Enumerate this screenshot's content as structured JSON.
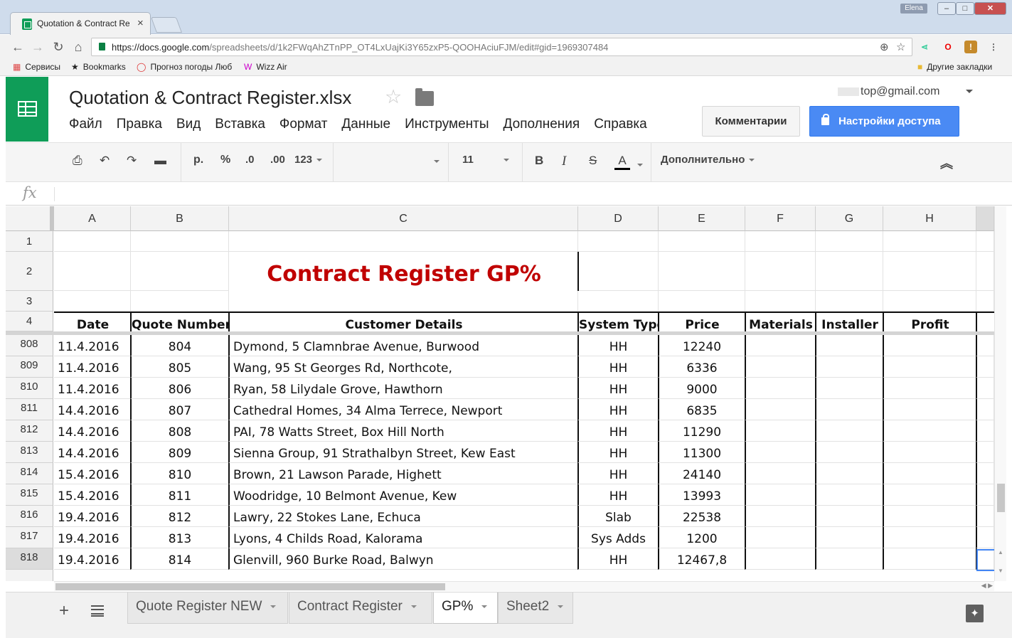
{
  "browser": {
    "tab_title": "Quotation & Contract Re",
    "tab_close": "×",
    "user_badge": "Elena",
    "url_host": "https://docs.google.com",
    "url_rest": "/spreadsheets/d/1k2FWqAhZTnPP_OT4LxUajKi3Y65zxP5-QOOHAciuFJM/edit#gid=1969307484",
    "bookmarks": [
      "Сервисы",
      "Bookmarks",
      "Прогноз погоды Люб",
      "Wizz Air"
    ],
    "other_bookmarks": "Другие закладки"
  },
  "doc": {
    "title": "Quotation & Contract Register.xlsx",
    "account": "top@gmail.com",
    "menu": [
      "Файл",
      "Правка",
      "Вид",
      "Вставка",
      "Формат",
      "Данные",
      "Инструменты",
      "Дополнения",
      "Справка"
    ],
    "comments_label": "Комментарии",
    "share_label": "Настройки доступа"
  },
  "toolbar": {
    "currency": "р.",
    "percent": "%",
    "dec_decrease": ".0",
    "dec_increase": ".00",
    "number_format": "123",
    "font_size": "11",
    "bold": "B",
    "italic": "I",
    "strike": "S",
    "text_color": "A",
    "more": "Дополнительно"
  },
  "formula_bar": {
    "fx": "fx",
    "value": ""
  },
  "sheet": {
    "columns": [
      "A",
      "B",
      "C",
      "D",
      "E",
      "F",
      "G",
      "H"
    ],
    "title": "Contract Register GP%",
    "headers": [
      "Date",
      "Quote Number",
      "Customer Details",
      "System Type",
      "Price",
      "Materials",
      "Installer",
      "Profit"
    ],
    "frozen_rows": [
      "1",
      "2",
      "3",
      "4"
    ],
    "rows": [
      {
        "num": "808",
        "date": "11.4.2016",
        "quote": "804",
        "customer": "Dymond, 5 Clamnbrae Avenue, Burwood",
        "system": "HH",
        "price": "12240"
      },
      {
        "num": "809",
        "date": "11.4.2016",
        "quote": "805",
        "customer": "Wang, 95 St Georges Rd, Northcote,",
        "system": "HH",
        "price": "6336"
      },
      {
        "num": "810",
        "date": "11.4.2016",
        "quote": "806",
        "customer": "Ryan, 58 Lilydale Grove, Hawthorn",
        "system": "HH",
        "price": "9000"
      },
      {
        "num": "811",
        "date": "14.4.2016",
        "quote": "807",
        "customer": "Cathedral Homes, 34 Alma Terrece, Newport",
        "system": "HH",
        "price": "6835"
      },
      {
        "num": "812",
        "date": "14.4.2016",
        "quote": "808",
        "customer": "PAI, 78 Watts Street, Box Hill North",
        "system": "HH",
        "price": "11290"
      },
      {
        "num": "813",
        "date": "14.4.2016",
        "quote": "809",
        "customer": "Sienna Group, 91 Strathalbyn Street, Kew East",
        "system": "HH",
        "price": "11300"
      },
      {
        "num": "814",
        "date": "15.4.2016",
        "quote": "810",
        "customer": "Brown, 21 Lawson Parade, Highett",
        "system": "HH",
        "price": "24140"
      },
      {
        "num": "815",
        "date": "15.4.2016",
        "quote": "811",
        "customer": "Woodridge, 10 Belmont Avenue, Kew",
        "system": "HH",
        "price": "13993"
      },
      {
        "num": "816",
        "date": "19.4.2016",
        "quote": "812",
        "customer": "Lawry, 22 Stokes Lane, Echuca",
        "system": "Slab",
        "price": "22538"
      },
      {
        "num": "817",
        "date": "19.4.2016",
        "quote": "813",
        "customer": "Lyons, 4 Childs Road, Kalorama",
        "system": "Sys Adds",
        "price": "1200"
      },
      {
        "num": "818",
        "date": "19.4.2016",
        "quote": "814",
        "customer": "Glenvill, 960 Burke Road, Balwyn",
        "system": "HH",
        "price": "12467,8"
      }
    ]
  },
  "sheet_tabs": [
    {
      "label": "Quote Register NEW",
      "active": false
    },
    {
      "label": "Contract  Register",
      "active": false
    },
    {
      "label": "GP%",
      "active": true
    },
    {
      "label": "Sheet2",
      "active": false
    }
  ],
  "colors": {
    "accent": "#0f9d58",
    "title_red": "#c00000",
    "share_blue": "#4a8af4",
    "selection": "#4285f4"
  }
}
